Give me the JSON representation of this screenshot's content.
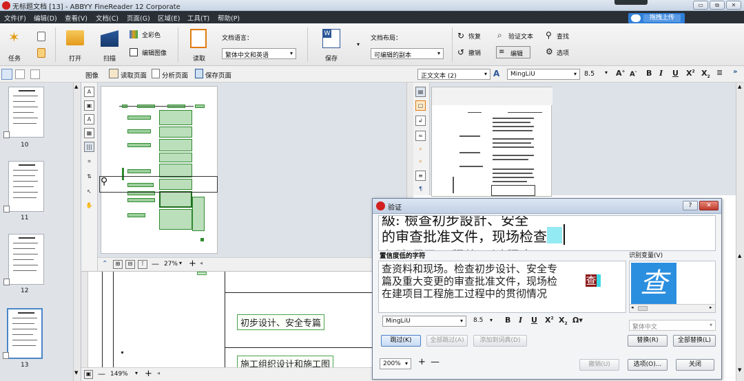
{
  "app": {
    "title": "无标题文档 [13] - ABBYY FineReader 12 Corporate",
    "window_buttons": [
      "▭",
      "⧉",
      "✕"
    ]
  },
  "menu": [
    "文件(F)",
    "编辑(D)",
    "查看(V)",
    "文档(C)",
    "页面(G)",
    "区域(E)",
    "工具(T)",
    "帮助(P)"
  ],
  "upload_label": "拖拽上传",
  "toolbar": {
    "task": "任务",
    "open": "打开",
    "scan": "扫描",
    "full_color": "全彩色",
    "edit_image": "编辑图像",
    "read": "读取",
    "doc_language_label": "文档语言：",
    "doc_language_value": "繁体中文和英语",
    "save": "保存",
    "doc_layout_label": "文档布局：",
    "doc_layout_value": "可编辑的副本",
    "redo": "恢复",
    "undo": "撤销",
    "verify_text": "验证文本",
    "edit": "编辑",
    "find": "查找",
    "options": "选项"
  },
  "viewbar": {
    "image_label": "图像",
    "read_page": "读取页面",
    "analyze_page": "分析页面",
    "save_page": "保存页面",
    "style": "正文文本 (2)",
    "font": "MingLiU",
    "size": "8.5",
    "more": "»"
  },
  "pages": [
    {
      "num": "10"
    },
    {
      "num": "11"
    },
    {
      "num": "12"
    },
    {
      "num": "13",
      "selected": true
    }
  ],
  "image_zoom": "27%",
  "zoom_zoom": "149%",
  "zoom_cells": [
    "初步设计、安全专篇",
    "施工组织设计和施工图"
  ],
  "verify": {
    "title": "验证",
    "image_lines": [
      "級: 檢查初步設計、安全",
      "的审查批准文件，现场检查",
      "在建项目工程施工过程中"
    ],
    "image_highlight": "查",
    "low_conf_label": "置信度低的字符",
    "variants_label": "识别变量(V)",
    "edit_lines": [
      "查资料和现场。检查初步设计、安全专",
      "篇及重大变更的审查批准文件，现场检",
      "在建项目工程施工过程中的贯彻情况"
    ],
    "edit_highlight": "查",
    "variant_char": "查",
    "font": "MingLiU",
    "size": "8.5",
    "language": "繁体中文",
    "skip": "跳过(K)",
    "skip_all": "全部跳过(A)",
    "add_dict": "添加到词典(D)",
    "replace": "替换(R)",
    "replace_all": "全部替换(L)",
    "zoom": "200%",
    "cancel": "撤销(U)",
    "options": "选项(O)...",
    "close": "关闭",
    "help_btn": "?",
    "close_btn": "✕"
  },
  "colors": {
    "menubar": "#2a2f36",
    "upload": "#2f7fd8",
    "highlight_cyan": "#3ad8e8",
    "highlight_dark": "#8b1a1a",
    "variant_bg": "#2b8fe0"
  }
}
